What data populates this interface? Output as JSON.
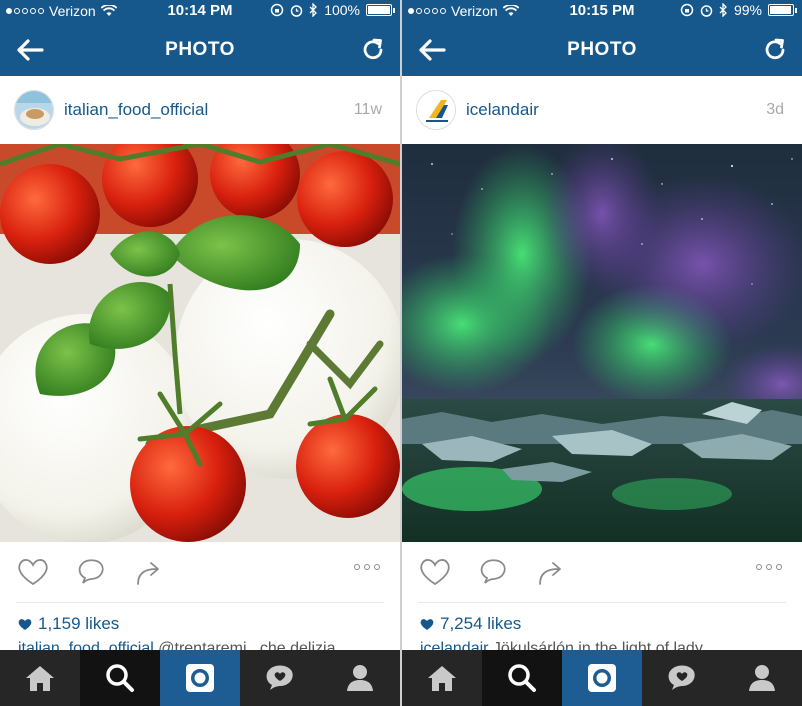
{
  "colors": {
    "brand": "#16588c",
    "tabbar": "#262626",
    "camera_tab": "#1d5d93"
  },
  "phones": [
    {
      "status": {
        "carrier": "Verizon",
        "time": "10:14 PM",
        "battery": "100%"
      },
      "nav": {
        "title": "PHOTO"
      },
      "post": {
        "username": "italian_food_official",
        "age": "11w",
        "likes": "1,159 likes",
        "caption_user": "italian_food_official",
        "caption_text": " @trentaremi...che delizia"
      }
    },
    {
      "status": {
        "carrier": "Verizon",
        "time": "10:15 PM",
        "battery": "99%"
      },
      "nav": {
        "title": "PHOTO"
      },
      "post": {
        "username": "icelandair",
        "age": "3d",
        "likes": "7,254 likes",
        "caption_user": "icelandair",
        "caption_text": " Jökulsárlón in the light of lady..."
      }
    }
  ],
  "tabs": [
    "home-icon",
    "search-icon",
    "camera-icon",
    "activity-heart-icon",
    "profile-icon"
  ]
}
